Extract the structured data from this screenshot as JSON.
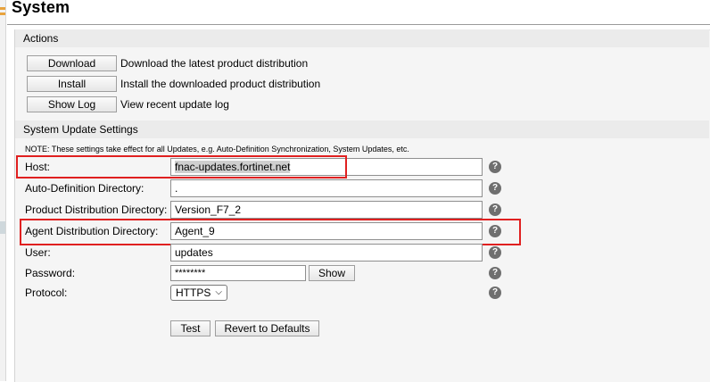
{
  "page": {
    "title": "System"
  },
  "actions": {
    "header": "Actions",
    "items": [
      {
        "button": "Download",
        "description": "Download the latest product distribution"
      },
      {
        "button": "Install",
        "description": "Install the downloaded product distribution"
      },
      {
        "button": "Show Log",
        "description": "View recent update log"
      }
    ]
  },
  "settings": {
    "header": "System Update Settings",
    "note": "NOTE: These settings take effect for all Updates, e.g. Auto-Definition Synchronization, System Updates, etc.",
    "host": {
      "label": "Host:",
      "value": "fnac-updates.fortinet.net"
    },
    "auto_def": {
      "label": "Auto-Definition Directory:",
      "value": "."
    },
    "product_dist": {
      "label": "Product Distribution Directory:",
      "value": "Version_F7_2"
    },
    "agent_dist": {
      "label": "Agent Distribution Directory:",
      "value": "Agent_9"
    },
    "user": {
      "label": "User:",
      "value": "updates"
    },
    "password": {
      "label": "Password:",
      "value": "********",
      "show_button": "Show"
    },
    "protocol": {
      "label": "Protocol:",
      "value": "HTTPS"
    },
    "help_glyph": "?",
    "test_button": "Test",
    "revert_button": "Revert to Defaults"
  },
  "colors": {
    "highlight_box": "#e02020",
    "panel_bg": "#f5f5f5",
    "header_bg": "#ebebeb"
  },
  "icons": {
    "help": "help-icon",
    "dropdown": "chevron-down-icon"
  }
}
